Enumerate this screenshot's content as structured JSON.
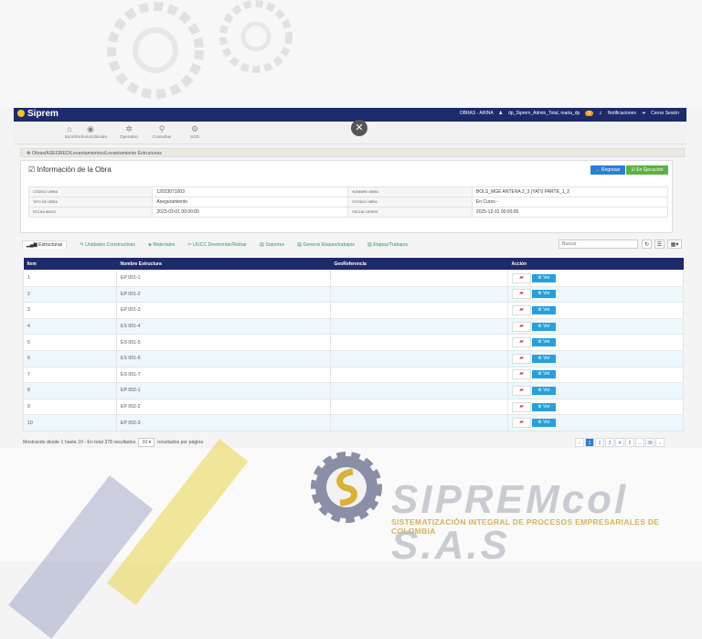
{
  "colors": {
    "navbar": "#1e2b6b",
    "accent_blue": "#2a7fd4",
    "success": "#5cb043",
    "tab_green": "#2a9d5a",
    "ver_button": "#27a0db"
  },
  "navbar": {
    "brand": "Siprem",
    "obras": "OBRAS - ARINA",
    "user": "dp_Siprem_Admin_Total, maria_dp",
    "notif_count": "0",
    "notifications": "Notificaciones",
    "logout": "Cerrar Sesión"
  },
  "toolbar": [
    {
      "icon": "home-icon",
      "glyph": "⌂",
      "label": "Inicio"
    },
    {
      "icon": "globe-icon",
      "glyph": "◉",
      "label": "Territorio/Ubicado"
    },
    {
      "icon": "gear-icon",
      "glyph": "✲",
      "label": "Operativo"
    },
    {
      "icon": "search-icon",
      "glyph": "⚲",
      "label": "Consultas"
    },
    {
      "icon": "cogs-icon",
      "glyph": "⚙",
      "label": "SGD"
    }
  ],
  "breadcrumb": "Obras/ASEGRED/Levantamientos/Levantamiento Estructuras",
  "panel": {
    "title": "Información de la Obra",
    "back_label": "Regresar",
    "state_label": "En Ejecución",
    "rows": [
      {
        "k1": "CÓDIGO OBRA",
        "v1": "12023071003",
        "k2": "NOMBRE OBRA",
        "v2": "BOLS_MGE ANTENA 2_3 (YATI) PARTE_1_2"
      },
      {
        "k1": "TIPO DE OBRA",
        "v1": "Aseguramiento",
        "k2": "ESTADO OBRA",
        "v2": "En Curso -"
      },
      {
        "k1": "FECHA INICIO",
        "v1": "2023-03-01 00:00:00",
        "k2": "FECHA CIERRE",
        "v2": "2025-12-31 00:00:00"
      }
    ]
  },
  "tabs": [
    {
      "label": "Estructuras",
      "glyph": "▂▄▆"
    },
    {
      "label": "Unidades Constructivas",
      "glyph": "✎"
    },
    {
      "label": "Materiales",
      "glyph": "◈"
    },
    {
      "label": "UUCC Desmontar/Retirar",
      "glyph": "✂"
    },
    {
      "label": "Soportes",
      "glyph": "▤"
    },
    {
      "label": "Generar Etapas/trabajos",
      "glyph": "▤"
    },
    {
      "label": "Etapas/Trabajos",
      "glyph": "▤"
    }
  ],
  "search": {
    "placeholder": "Buscar"
  },
  "table": {
    "headers": [
      "Item",
      "Nombre Estructura",
      "GeoReferencia",
      "Acción"
    ],
    "ver_label": "Ver",
    "rows": [
      {
        "item": "1",
        "name": "EP 001-1",
        "geo": ""
      },
      {
        "item": "2",
        "name": "EP 001-2",
        "geo": ""
      },
      {
        "item": "3",
        "name": "EP 001-3",
        "geo": ""
      },
      {
        "item": "4",
        "name": "ES 001-4",
        "geo": ""
      },
      {
        "item": "5",
        "name": "ES 001-5",
        "geo": ""
      },
      {
        "item": "6",
        "name": "ES 001-6",
        "geo": ""
      },
      {
        "item": "7",
        "name": "ES 001-7",
        "geo": ""
      },
      {
        "item": "8",
        "name": "EP 002-1",
        "geo": ""
      },
      {
        "item": "9",
        "name": "EP 002-2",
        "geo": ""
      },
      {
        "item": "10",
        "name": "EP 002-3",
        "geo": ""
      }
    ]
  },
  "footer": {
    "showing": "Mostrando desde 1 hasta 10 - En total 378 resultados",
    "per_page_value": "10",
    "per_page_suffix": "resultados por página",
    "pages": [
      "‹",
      "1",
      "2",
      "3",
      "4",
      "5",
      "...",
      "38",
      "›"
    ],
    "current_page": "1"
  },
  "branding": {
    "name": "SIPREMcol S.A.S",
    "tagline": "SISTEMATIZACIÓN INTEGRAL DE PROCESOS EMPRESARIALES DE COLOMBIA"
  }
}
